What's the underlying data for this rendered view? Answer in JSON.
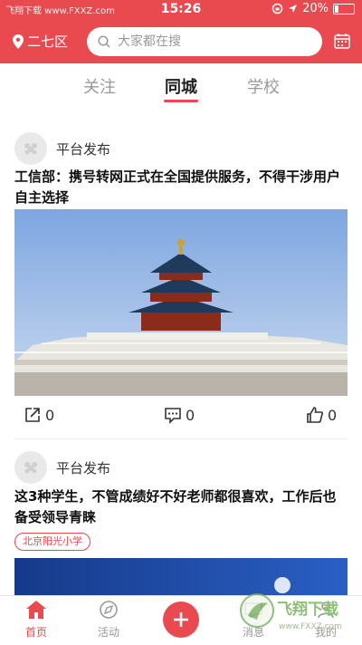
{
  "status_bar": {
    "watermark": "飞翔下载 www.FXXZ.com",
    "time": "15:26",
    "battery": "20%",
    "battery_level": 0.2
  },
  "header": {
    "location": "二七区",
    "search_placeholder": "大家都在搜"
  },
  "tabs": [
    {
      "label": "关注"
    },
    {
      "label": "同城",
      "active": true
    },
    {
      "label": "学校"
    }
  ],
  "feed": [
    {
      "author": "平台发布",
      "title": "工信部：携号转网正式在全国提供服务，不得干涉用户自主选择",
      "share_count": "0",
      "comment_count": "0",
      "like_count": "0"
    },
    {
      "author": "平台发布",
      "title": "这3种学生，不管成绩好不好老师都很喜欢，工作后也备受领导青睐",
      "tag": "北京阳光小学"
    }
  ],
  "tab_bar": {
    "items": [
      {
        "label": "首页",
        "active": true
      },
      {
        "label": "活动"
      },
      {
        "label": "消息"
      },
      {
        "label": "我的"
      }
    ]
  },
  "watermark_logo": {
    "text": "飞翔下载",
    "url": "www.FXXZ.com"
  },
  "colors": {
    "brand": "#e84a4f"
  }
}
